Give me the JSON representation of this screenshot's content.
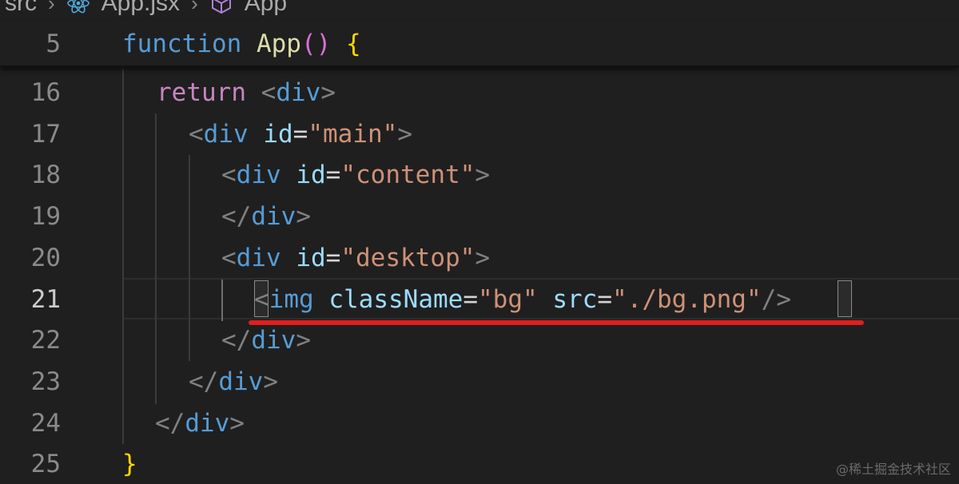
{
  "breadcrumb": {
    "folder": "src",
    "file": "App.jsx",
    "symbol": "App",
    "file_icon": "react-icon",
    "symbol_icon": "cube-icon"
  },
  "sticky_line": {
    "number": "5",
    "tokens": [
      {
        "t": "function",
        "c": "kw-fn"
      },
      {
        "t": " ",
        "c": ""
      },
      {
        "t": "App",
        "c": "fn-name"
      },
      {
        "t": "()",
        "c": "paren"
      },
      {
        "t": " ",
        "c": ""
      },
      {
        "t": "{",
        "c": "brace"
      }
    ]
  },
  "lines": [
    {
      "number": "16",
      "tokens": [
        {
          "t": "return",
          "c": "kw-ret"
        },
        {
          "t": " ",
          "c": ""
        },
        {
          "t": "<",
          "c": "tag-b"
        },
        {
          "t": "div",
          "c": "tag"
        },
        {
          "t": ">",
          "c": "tag-b"
        }
      ]
    },
    {
      "number": "17",
      "tokens": [
        {
          "t": "<",
          "c": "tag-b"
        },
        {
          "t": "div",
          "c": "tag"
        },
        {
          "t": " ",
          "c": ""
        },
        {
          "t": "id",
          "c": "attr"
        },
        {
          "t": "=",
          "c": "eq"
        },
        {
          "t": "\"main\"",
          "c": "str"
        },
        {
          "t": ">",
          "c": "tag-b"
        }
      ]
    },
    {
      "number": "18",
      "tokens": [
        {
          "t": "<",
          "c": "tag-b"
        },
        {
          "t": "div",
          "c": "tag"
        },
        {
          "t": " ",
          "c": ""
        },
        {
          "t": "id",
          "c": "attr"
        },
        {
          "t": "=",
          "c": "eq"
        },
        {
          "t": "\"content\"",
          "c": "str"
        },
        {
          "t": ">",
          "c": "tag-b"
        }
      ]
    },
    {
      "number": "19",
      "tokens": [
        {
          "t": "</",
          "c": "tag-b"
        },
        {
          "t": "div",
          "c": "tag"
        },
        {
          "t": ">",
          "c": "tag-b"
        }
      ]
    },
    {
      "number": "20",
      "tokens": [
        {
          "t": "<",
          "c": "tag-b"
        },
        {
          "t": "div",
          "c": "tag"
        },
        {
          "t": " ",
          "c": ""
        },
        {
          "t": "id",
          "c": "attr"
        },
        {
          "t": "=",
          "c": "eq"
        },
        {
          "t": "\"desktop\"",
          "c": "str"
        },
        {
          "t": ">",
          "c": "tag-b"
        }
      ]
    },
    {
      "number": "21",
      "active": true,
      "tokens": [
        {
          "t": "<",
          "c": "tag-b"
        },
        {
          "t": "img",
          "c": "tag"
        },
        {
          "t": " ",
          "c": ""
        },
        {
          "t": "className",
          "c": "attr"
        },
        {
          "t": "=",
          "c": "eq"
        },
        {
          "t": "\"bg\"",
          "c": "str"
        },
        {
          "t": " ",
          "c": ""
        },
        {
          "t": "src",
          "c": "attr"
        },
        {
          "t": "=",
          "c": "eq"
        },
        {
          "t": "\"./bg.png\"",
          "c": "str"
        },
        {
          "t": "/",
          "c": "tag-b"
        },
        {
          "t": ">",
          "c": "tag-b"
        }
      ]
    },
    {
      "number": "22",
      "tokens": [
        {
          "t": "</",
          "c": "tag-b"
        },
        {
          "t": "div",
          "c": "tag"
        },
        {
          "t": ">",
          "c": "tag-b"
        }
      ]
    },
    {
      "number": "23",
      "tokens": [
        {
          "t": "</",
          "c": "tag-b"
        },
        {
          "t": "div",
          "c": "tag"
        },
        {
          "t": ">",
          "c": "tag-b"
        }
      ]
    },
    {
      "number": "24",
      "tokens": [
        {
          "t": "</",
          "c": "tag-b"
        },
        {
          "t": "div",
          "c": "tag"
        },
        {
          "t": ">",
          "c": "tag-b"
        }
      ]
    },
    {
      "number": "25",
      "tokens": [
        {
          "t": "}",
          "c": "brace"
        }
      ]
    }
  ],
  "watermark": "@稀土掘金技术社区",
  "colors": {
    "background": "#1f1f1f",
    "keyword": "#569cd6",
    "function_name": "#dcdcaa",
    "return_keyword": "#c586c0",
    "attribute": "#9cdcfe",
    "string": "#ce9178",
    "bracket": "#ffd700",
    "highlight_underline": "#e01e1e"
  }
}
